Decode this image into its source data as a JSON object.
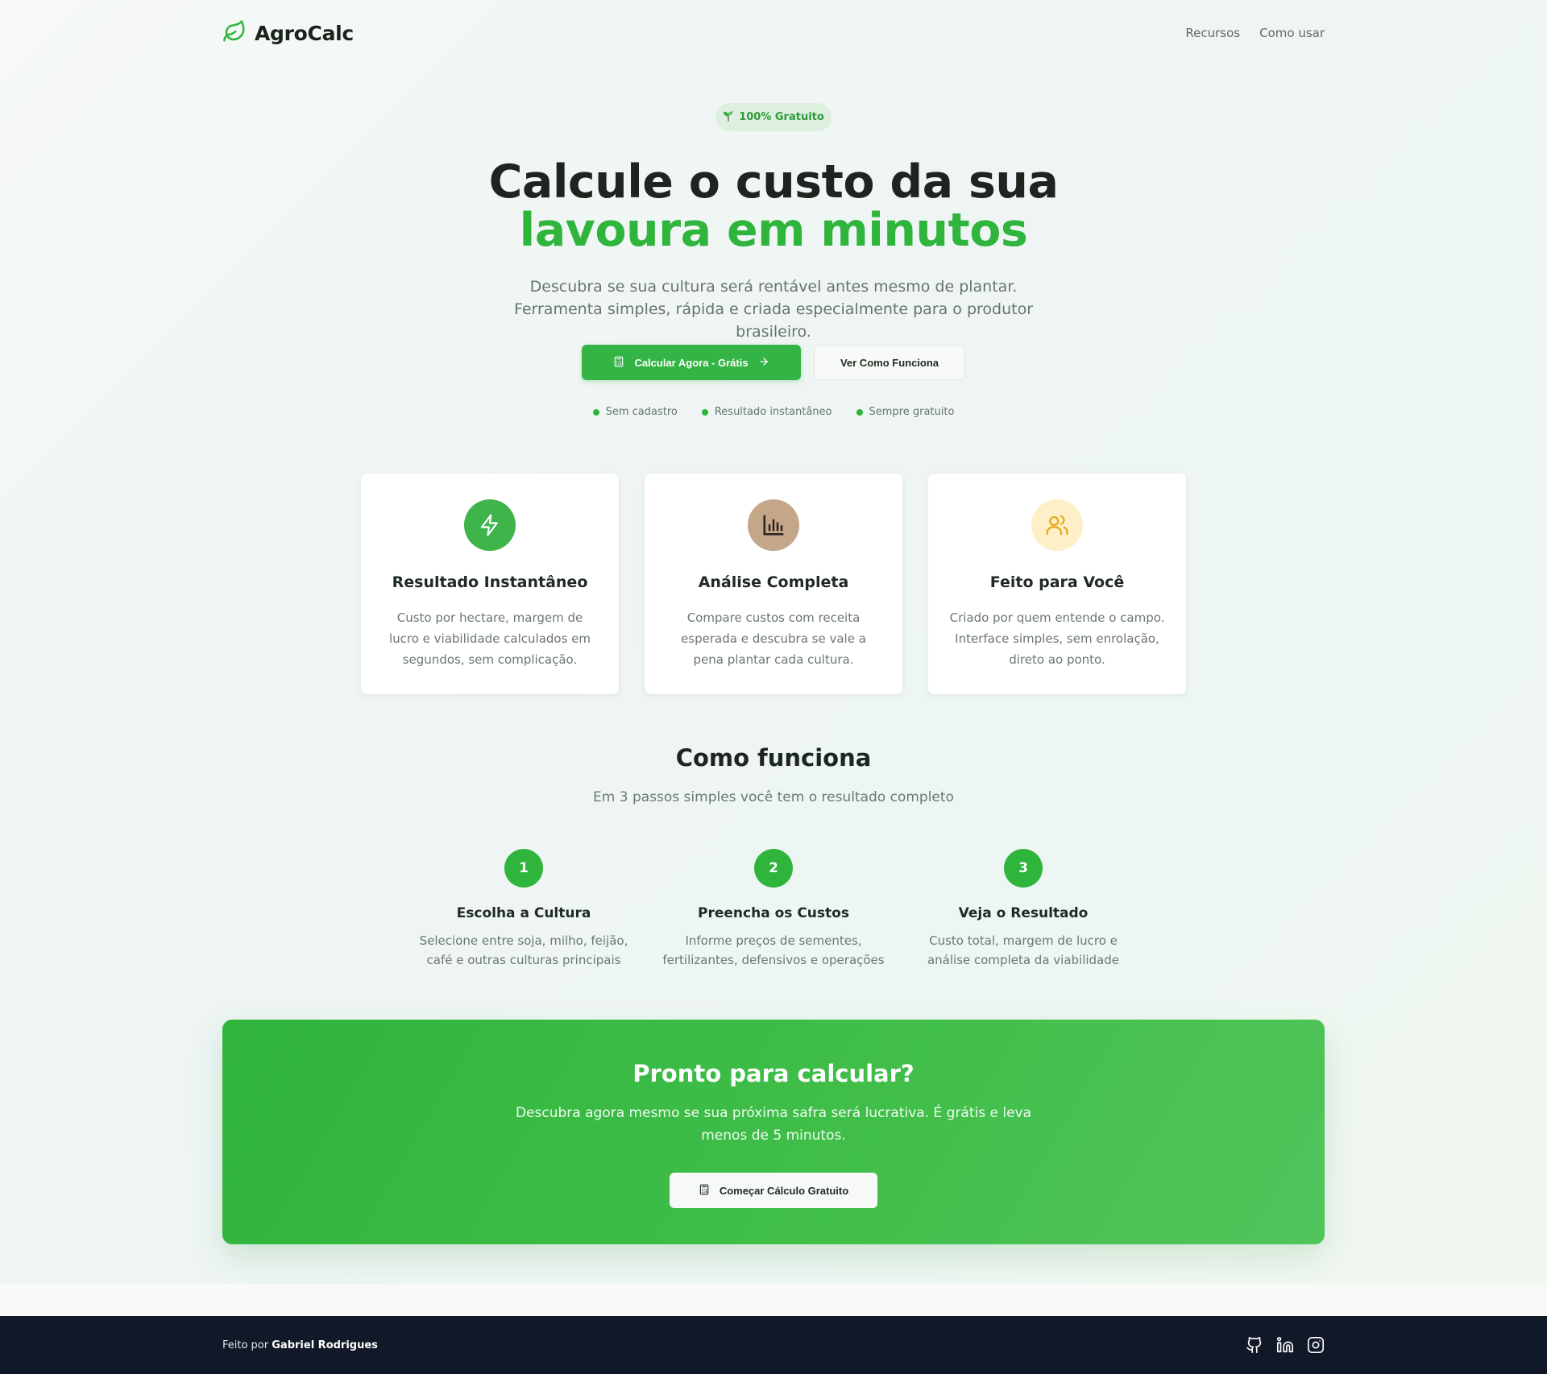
{
  "header": {
    "brand": "AgroCalc",
    "nav": [
      "Recursos",
      "Como usar"
    ]
  },
  "hero": {
    "badge": "100% Gratuito",
    "title_line1": "Calcule o custo da sua",
    "title_line2": "lavoura em minutos",
    "subtitle": "Descubra se sua cultura será rentável antes mesmo de plantar. Ferramenta simples, rápida e criada especialmente para o produtor brasileiro.",
    "primary_button": "Calcular Agora - Grátis",
    "secondary_button": "Ver Como Funciona",
    "checks": [
      "Sem cadastro",
      "Resultado instantâneo",
      "Sempre gratuito"
    ]
  },
  "features": [
    {
      "icon": "lightning-icon",
      "title": "Resultado Instantâneo",
      "desc": "Custo por hectare, margem de lucro e viabilidade calculados em segundos, sem complicação.",
      "color": "#3fb44a"
    },
    {
      "icon": "bar-chart-icon",
      "title": "Análise Completa",
      "desc": "Compare custos com receita esperada e descubra se vale a pena plantar cada cultura.",
      "color": "#c4a688"
    },
    {
      "icon": "users-icon",
      "title": "Feito para Você",
      "desc": "Criado por quem entende o campo. Interface simples, sem enrolação, direto ao ponto.",
      "color": "#fdf0c8"
    }
  ],
  "how": {
    "title": "Como funciona",
    "subtitle": "Em 3 passos simples você tem o resultado completo",
    "steps": [
      {
        "num": "1",
        "title": "Escolha a Cultura",
        "desc": "Selecione entre soja, milho, feijão, café e outras culturas principais"
      },
      {
        "num": "2",
        "title": "Preencha os Custos",
        "desc": "Informe preços de sementes, fertilizantes, defensivos e operações"
      },
      {
        "num": "3",
        "title": "Veja o Resultado",
        "desc": "Custo total, margem de lucro e análise completa da viabilidade"
      }
    ]
  },
  "cta": {
    "title": "Pronto para calcular?",
    "desc": "Descubra agora mesmo se sua próxima safra será lucrativa. É grátis e leva menos de 5 minutos.",
    "button": "Começar Cálculo Gratuito"
  },
  "footer": {
    "prefix": "Feito por",
    "author": "Gabriel Rodrigues",
    "socials": [
      "github-icon",
      "linkedin-icon",
      "instagram-icon"
    ]
  },
  "colors": {
    "accent": "#2fb43c",
    "footer_bg": "#111827"
  }
}
